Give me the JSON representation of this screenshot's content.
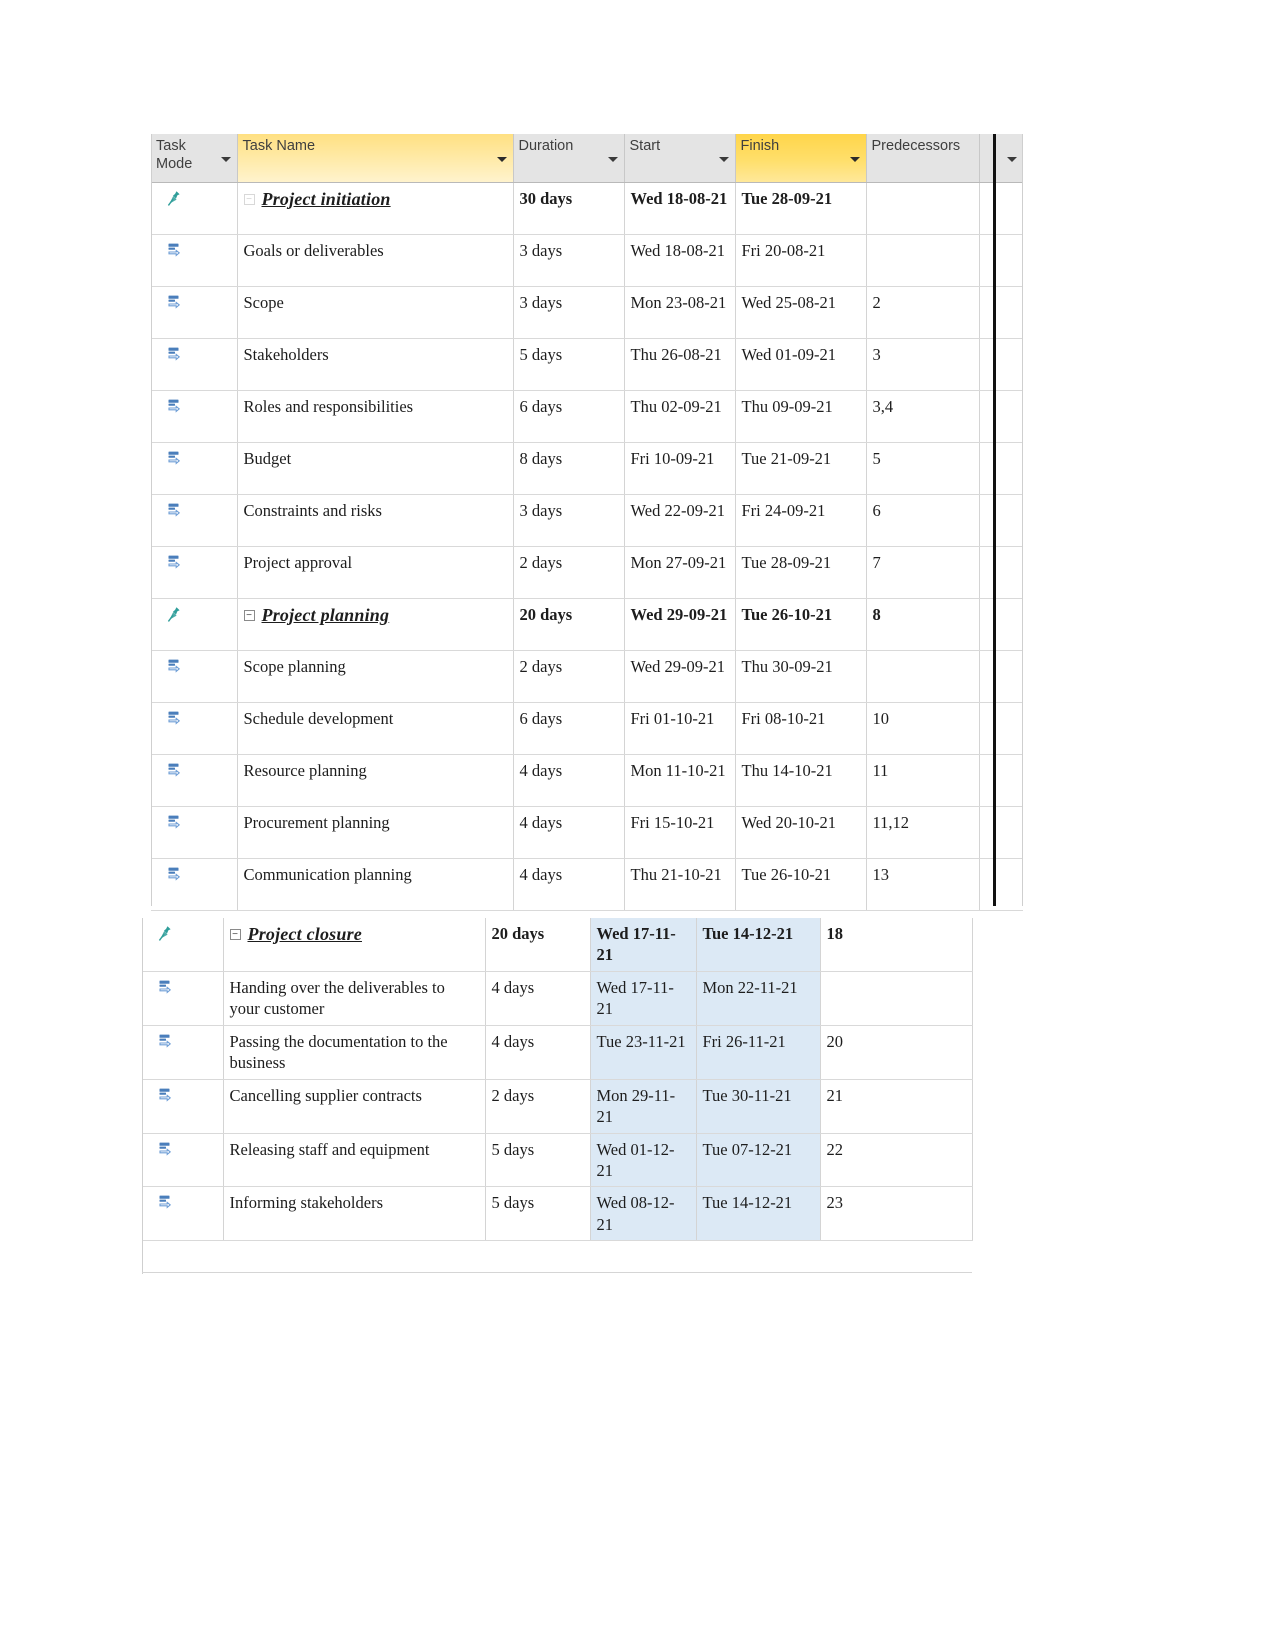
{
  "table": {
    "columns": [
      {
        "key": "task_mode",
        "label": "Task\nMode",
        "style": "grey"
      },
      {
        "key": "task_name",
        "label": "Task Name",
        "style": "gold"
      },
      {
        "key": "duration",
        "label": "Duration",
        "style": "grey"
      },
      {
        "key": "start",
        "label": "Start",
        "style": "grey"
      },
      {
        "key": "finish",
        "label": "Finish",
        "style": "gold2"
      },
      {
        "key": "predecessors",
        "label": "Predecessors",
        "style": "grey"
      }
    ],
    "header_labels": {
      "task_mode_line1": "Task",
      "task_mode_line2": "Mode",
      "task_name": "Task Name",
      "duration": "Duration",
      "start": "Start",
      "finish": "Finish",
      "predecessors": "Predecessors"
    },
    "icons": {
      "manual_mode": "pushpin-icon",
      "auto_mode": "auto-schedule-icon",
      "filter": "filter-dropdown-icon",
      "collapse": "collapse-minus-icon"
    }
  },
  "section_top": {
    "rows": [
      {
        "mode": "pushpin",
        "name": "Project initiation",
        "level": 0,
        "summary": true,
        "expander": "ghost",
        "duration": "30 days",
        "start": "Wed 18-08-21",
        "finish": "Tue 28-09-21",
        "predecessors": ""
      },
      {
        "mode": "manual",
        "name": "Goals or deliverables",
        "level": 1,
        "summary": false,
        "expander": "none",
        "duration": "3 days",
        "start": "Wed 18-08-21",
        "finish": "Fri 20-08-21",
        "predecessors": ""
      },
      {
        "mode": "manual",
        "name": "Scope",
        "level": 1,
        "summary": false,
        "expander": "none",
        "duration": "3 days",
        "start": "Mon 23-08-21",
        "finish": "Wed 25-08-21",
        "predecessors": "2"
      },
      {
        "mode": "manual",
        "name": "Stakeholders",
        "level": 1,
        "summary": false,
        "expander": "none",
        "duration": "5 days",
        "start": "Thu 26-08-21",
        "finish": "Wed 01-09-21",
        "predecessors": "3"
      },
      {
        "mode": "manual",
        "name": "Roles and responsibilities",
        "level": 1,
        "summary": false,
        "expander": "none",
        "duration": "6 days",
        "start": "Thu 02-09-21",
        "finish": "Thu 09-09-21",
        "predecessors": "3,4"
      },
      {
        "mode": "manual",
        "name": "Budget",
        "level": 1,
        "summary": false,
        "expander": "none",
        "duration": "8 days",
        "start": "Fri 10-09-21",
        "finish": "Tue 21-09-21",
        "predecessors": "5"
      },
      {
        "mode": "manual",
        "name": "Constraints and risks",
        "level": 1,
        "summary": false,
        "expander": "none",
        "duration": "3 days",
        "start": "Wed 22-09-21",
        "finish": "Fri 24-09-21",
        "predecessors": "6"
      },
      {
        "mode": "manual",
        "name": "Project approval",
        "level": 1,
        "summary": false,
        "expander": "none",
        "duration": "2 days",
        "start": "Mon 27-09-21",
        "finish": "Tue 28-09-21",
        "predecessors": "7"
      },
      {
        "mode": "pushpin",
        "name": "Project planning",
        "level": 0,
        "summary": true,
        "expander": "minus",
        "duration": "20 days",
        "start": "Wed 29-09-21",
        "finish": "Tue 26-10-21",
        "predecessors": "8"
      },
      {
        "mode": "manual",
        "name": "Scope planning",
        "level": 1,
        "summary": false,
        "expander": "none",
        "duration": "2 days",
        "start": "Wed 29-09-21",
        "finish": "Thu 30-09-21",
        "predecessors": ""
      },
      {
        "mode": "manual",
        "name": "Schedule development",
        "level": 1,
        "summary": false,
        "expander": "none",
        "duration": "6 days",
        "start": "Fri 01-10-21",
        "finish": "Fri 08-10-21",
        "predecessors": "10"
      },
      {
        "mode": "manual",
        "name": "Resource planning",
        "level": 1,
        "summary": false,
        "expander": "none",
        "duration": "4 days",
        "start": "Mon 11-10-21",
        "finish": "Thu 14-10-21",
        "predecessors": "11"
      },
      {
        "mode": "manual",
        "name": "Procurement planning",
        "level": 1,
        "summary": false,
        "expander": "none",
        "duration": "4 days",
        "start": "Fri 15-10-21",
        "finish": "Wed 20-10-21",
        "predecessors": "11,12"
      },
      {
        "mode": "manual",
        "name": "Communication planning",
        "level": 1,
        "summary": false,
        "expander": "none",
        "duration": "4 days",
        "start": "Thu 21-10-21",
        "finish": "Tue 26-10-21",
        "predecessors": "13"
      }
    ]
  },
  "section_bottom": {
    "rows": [
      {
        "mode": "pushpin",
        "name": "Project closure",
        "level": 0,
        "summary": true,
        "expander": "minus",
        "duration": "20 days",
        "start": "Wed 17-11-21",
        "finish": "Tue 14-12-21",
        "predecessors": "18"
      },
      {
        "mode": "manual",
        "name": "Handing over the deliverables to your customer",
        "level": 1,
        "summary": false,
        "expander": "none",
        "duration": "4 days",
        "start": "Wed 17-11-21",
        "finish": "Mon 22-11-21",
        "predecessors": ""
      },
      {
        "mode": "manual",
        "name": "Passing the documentation to the business",
        "level": 1,
        "summary": false,
        "expander": "none",
        "duration": "4 days",
        "start": "Tue 23-11-21",
        "finish": "Fri 26-11-21",
        "predecessors": "20"
      },
      {
        "mode": "manual",
        "name": "Cancelling supplier contracts",
        "level": 1,
        "summary": false,
        "expander": "none",
        "duration": "2 days",
        "start": "Mon 29-11-21",
        "finish": "Tue 30-11-21",
        "predecessors": "21"
      },
      {
        "mode": "manual",
        "name": "Releasing staff and equipment",
        "level": 1,
        "summary": false,
        "expander": "none",
        "duration": "5 days",
        "start": "Wed 01-12-21",
        "finish": "Tue 07-12-21",
        "predecessors": "22"
      },
      {
        "mode": "manual",
        "name": "Informing stakeholders",
        "level": 1,
        "summary": false,
        "expander": "none",
        "duration": "5 days",
        "start": "Wed 08-12-21",
        "finish": "Tue 14-12-21",
        "predecessors": "23"
      }
    ]
  },
  "colors": {
    "header_gold": "#ffe082",
    "header_gold_active": "#ffd54a",
    "header_grey": "#e4e4e4",
    "selection_blue": "#dce9f5",
    "pushpin_teal": "#2f9e9a",
    "mode_icon_blue": "#4a7ebb"
  }
}
